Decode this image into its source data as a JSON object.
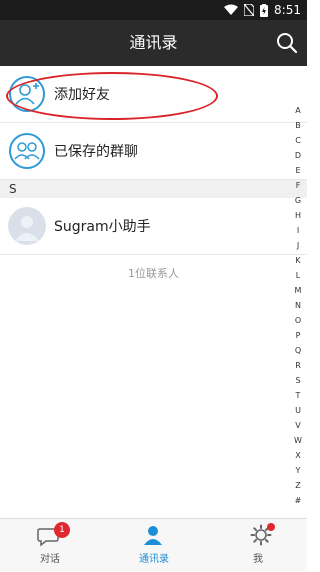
{
  "status": {
    "time": "8:51"
  },
  "header": {
    "title": "通讯录",
    "search_icon": "search-icon"
  },
  "list": {
    "add_friend": {
      "label": "添加好友",
      "icon": "add-friend-icon"
    },
    "saved_groups": {
      "label": "已保存的群聊",
      "icon": "group-chat-icon"
    },
    "section": "S",
    "contacts": [
      {
        "name": "Sugram小助手"
      }
    ],
    "count_text": "1位联系人"
  },
  "index_letters": [
    "A",
    "B",
    "C",
    "D",
    "E",
    "F",
    "G",
    "H",
    "I",
    "J",
    "K",
    "L",
    "M",
    "N",
    "O",
    "P",
    "Q",
    "R",
    "S",
    "T",
    "U",
    "V",
    "W",
    "X",
    "Y",
    "Z",
    "#"
  ],
  "tabs": [
    {
      "label": "对话",
      "icon": "chat-icon",
      "badge": "1"
    },
    {
      "label": "通讯录",
      "icon": "contacts-icon",
      "active": true
    },
    {
      "label": "我",
      "icon": "me-gear-icon",
      "dot": true
    }
  ],
  "colors": {
    "accent": "#1e8fd6",
    "header": "#2b2b2b",
    "badge": "#e0292f",
    "annotation": "#d9242a"
  }
}
